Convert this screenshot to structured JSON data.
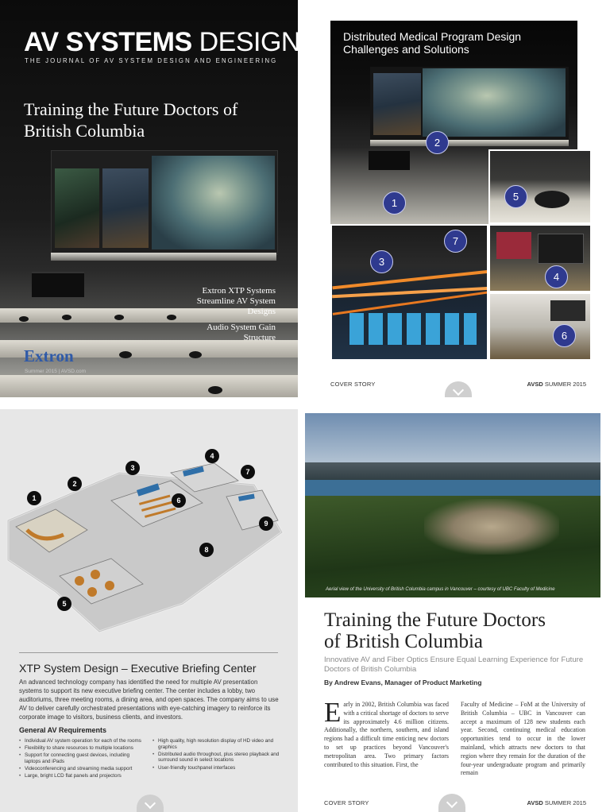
{
  "cover": {
    "brand_bold": "AV SYSTEMS",
    "brand_light": "DESIGN",
    "subtitle": "THE JOURNAL OF AV SYSTEM DESIGN AND ENGINEERING",
    "headline": "Training the Future Doctors of British Columbia",
    "teaser_1": "Extron XTP Systems Streamline AV System Designs",
    "teaser_2": "Audio System Gain Structure",
    "sponsor": "Extron",
    "issue": "Summer 2015 | AVSD.com"
  },
  "collage": {
    "heading_line1": "Distributed Medical Program Design",
    "heading_line2": "Challenges and Solutions",
    "markers": [
      "1",
      "2",
      "3",
      "4",
      "5",
      "6",
      "7"
    ],
    "footer_left": "COVER STORY",
    "footer_brand": "AVSD",
    "footer_issue": "SUMMER 2015"
  },
  "floorplan": {
    "markers": [
      "1",
      "2",
      "3",
      "4",
      "5",
      "6",
      "7",
      "8",
      "9"
    ],
    "title": "XTP System Design – Executive Briefing Center",
    "body": "An advanced technology company has identified the need for multiple AV presentation systems to support its new executive briefing center. The center includes a lobby, two auditoriums, three meeting rooms, a dining area, and open spaces. The company aims to use AV to deliver carefully orchestrated presentations with eye-catching imagery to reinforce its corporate image to visitors, business clients, and investors.",
    "req_heading": "General AV Requirements",
    "req_left": [
      "Individual AV system operation for each of the rooms",
      "Flexibility to share resources to multiple locations",
      "Support for connecting guest devices, including laptops and iPads",
      "Videoconferencing and streaming media support",
      "Large, bright LCD flat panels and projectors"
    ],
    "req_right": [
      "High quality, high resolution display of HD video and graphics",
      "Distributed audio throughout, plus stereo playback and surround sound in select locations",
      "User-friendly touchpanel interfaces"
    ]
  },
  "article": {
    "photo_credit": "Aerial view of the University of British Columbia campus in Vancouver – courtesy of UBC Faculty of Medicine",
    "title_line1": "Training the Future Doctors",
    "title_line2": "of British Columbia",
    "deck": "Innovative AV and Fiber Optics Ensure Equal Learning Experience for Future Doctors of British Columbia",
    "byline": "By Andrew Evans, Manager of Product Marketing",
    "dropcap": "E",
    "col1": "arly in 2002, British Columbia was faced with a critical shortage of doctors to serve its approximately 4.6 million citizens. Additionally, the northern, southern, and island regions had a difficult time enticing new doctors to set up practices beyond Vancouver's metropolitan area. Two primary factors contributed to this situation. First, the",
    "col2": "Faculty of Medicine – FoM at the University of British Columbia – UBC in Vancouver can accept a maximum of 128 new students each year. Second, continuing medical education opportunities tend to occur in the lower mainland, which attracts new doctors to that region where they remain for the duration of the four-year undergraduate program and primarily remain",
    "footer_left": "COVER STORY",
    "footer_brand": "AVSD",
    "footer_issue": "SUMMER 2015"
  }
}
